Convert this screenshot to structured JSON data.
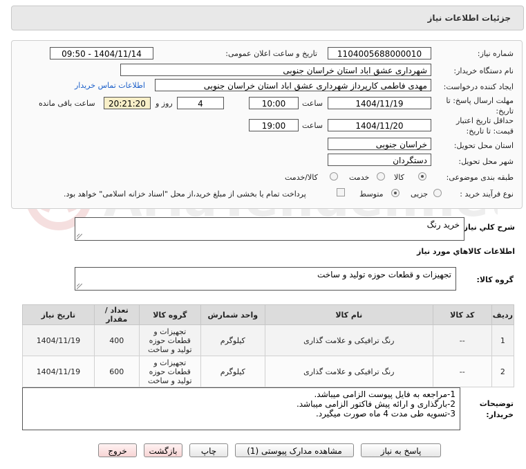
{
  "header": {
    "title": "جزئیات اطلاعات نیاز"
  },
  "form": {
    "need_number_label": "شماره نیاز:",
    "need_number": "1104005688000010",
    "announce_label": "تاریخ و ساعت اعلان عمومی:",
    "announce_value": "1404/11/14 - 09:50",
    "buyer_org_label": "نام دستگاه خریدار:",
    "buyer_org": "شهرداری عشق اباد استان خراسان جنوبی",
    "requester_label": "ایجاد کننده درخواست:",
    "requester": "مهدی فاطمی کارپرداز شهرداری عشق اباد استان خراسان جنوبی",
    "contact_link": "اطلاعات تماس خریدار",
    "reply_deadline_label": "مهلت ارسال پاسخ: تا تاریخ:",
    "reply_date": "1404/11/19",
    "time_label": "ساعت",
    "reply_time": "10:00",
    "days_value": "4",
    "days_label": "روز و",
    "remaining_time": "20:21:20",
    "remaining_label": "ساعت باقی مانده",
    "price_validity_label": "حداقل تاریخ اعتبار قیمت: تا تاریخ:",
    "validity_date": "1404/11/20",
    "validity_time": "19:00",
    "province_label": "استان محل تحویل:",
    "province": "خراسان جنوبی",
    "city_label": "شهر محل تحویل:",
    "city": "دستگردان",
    "category_label": "طبقه بندی موضوعی:",
    "category_options": [
      "کالا",
      "خدمت",
      "کالا/خدمت"
    ],
    "category_selected": "کالا",
    "process_label": "نوع فرآیند خرید :",
    "process_options": [
      "جزیی",
      "متوسط"
    ],
    "process_selected": "جزیی",
    "payment_note": "پرداخت تمام یا بخشی از مبلغ خرید،از محل \"اسناد خزانه اسلامی\" خواهد بود."
  },
  "summary": {
    "label": "شرح کلي نياز:",
    "value": "خرید رنگ"
  },
  "goods_info_title": "اطلاعات کالاهاي مورد نياز",
  "goods_group": {
    "label": "گروه کالا:",
    "value": "تجهیزات و قطعات حوزه تولید و ساخت"
  },
  "table": {
    "headers": [
      "ردیف",
      "کد کالا",
      "نام کالا",
      "واحد شمارش",
      "گروه کالا",
      "تعداد / مقدار",
      "تاریخ نیاز"
    ],
    "rows": [
      [
        "1",
        "--",
        "رنگ ترافیکی و علامت گذاری",
        "کیلوگرم",
        "تجهیزات و قطعات حوزه تولید و ساخت",
        "400",
        "1404/11/19"
      ],
      [
        "2",
        "--",
        "رنگ ترافیکی و علامت گذاری",
        "کیلوگرم",
        "تجهیزات و قطعات حوزه تولید و ساخت",
        "600",
        "1404/11/19"
      ]
    ]
  },
  "buyer_notes": {
    "label": "توضیحات خریدار:",
    "lines": [
      "1-مراجعه به فایل پیوست الزامی میباشد.",
      "2-بارگذاری و ارائه پیش فاکتور الزامی میباشد.",
      "3-تسویه طی مدت 4 ماه صورت میگیرد."
    ]
  },
  "buttons": {
    "reply": "پاسخ به نیاز",
    "attachments": "مشاهده مدارک پیوستی (1)",
    "print": "چاپ",
    "back": "بازگشت",
    "exit": "خروج"
  },
  "watermark": {
    "text": "AriaTender.net"
  },
  "colors": {
    "link": "#1b5fc9",
    "time_highlight": "#f8efc8",
    "header_bg": "#e8e8e8"
  }
}
